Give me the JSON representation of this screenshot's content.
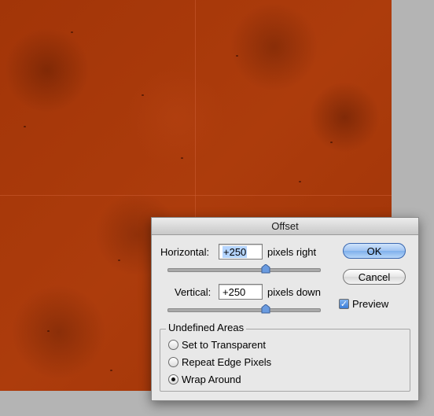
{
  "dialog": {
    "title": "Offset",
    "horizontal": {
      "label": "Horizontal:",
      "value": "+250",
      "unit": "pixels right"
    },
    "vertical": {
      "label": "Vertical:",
      "value": "+250",
      "unit": "pixels down"
    },
    "buttons": {
      "ok": "OK",
      "cancel": "Cancel"
    },
    "preview": {
      "label": "Preview",
      "checked": true
    },
    "undefined_areas": {
      "title": "Undefined Areas",
      "options": [
        {
          "label": "Set to Transparent",
          "selected": false
        },
        {
          "label": "Repeat Edge Pixels",
          "selected": false
        },
        {
          "label": "Wrap Around",
          "selected": true
        }
      ]
    }
  },
  "colors": {
    "canvas": "#a8380a",
    "workspace": "#b4b4b4",
    "dialog_bg": "#e8e8e8",
    "default_button": "#7fb0ec"
  }
}
